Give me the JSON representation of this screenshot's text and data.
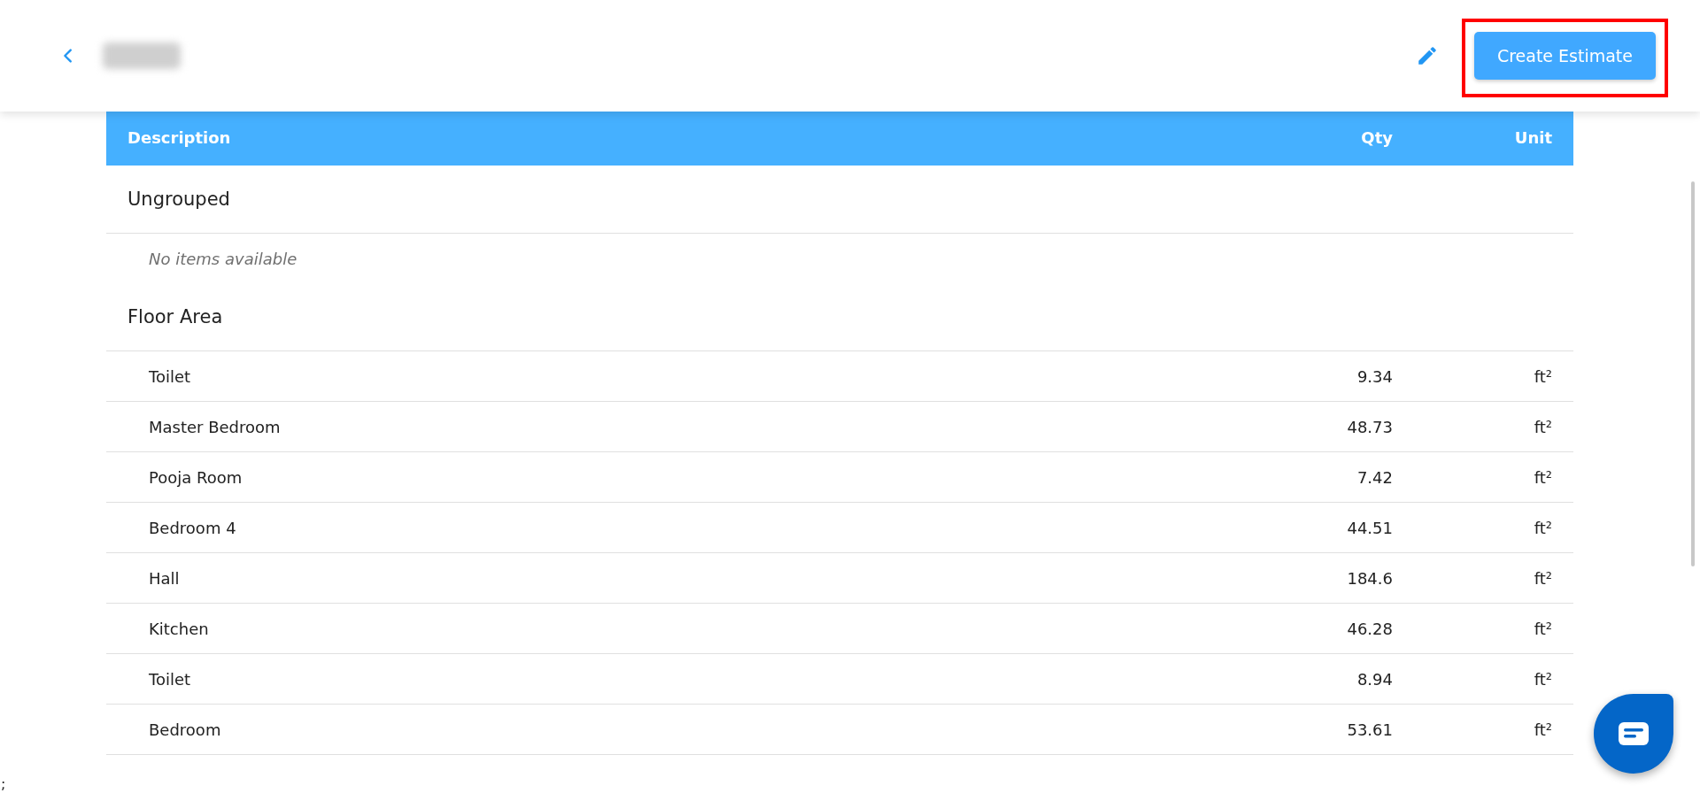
{
  "header": {
    "button": "Create Estimate",
    "highlighted": true
  },
  "table": {
    "columns": [
      "Description",
      "Qty",
      "Unit"
    ],
    "groups": [
      {
        "name": "Ungrouped",
        "empty_text": "No items available"
      },
      {
        "name": "Floor Area",
        "rows": [
          {
            "description": "Toilet",
            "qty": "9.34",
            "unit": "ft²"
          },
          {
            "description": "Master Bedroom",
            "qty": "48.73",
            "unit": "ft²"
          },
          {
            "description": "Pooja Room",
            "qty": "7.42",
            "unit": "ft²"
          },
          {
            "description": "Bedroom 4",
            "qty": "44.51",
            "unit": "ft²"
          },
          {
            "description": "Hall",
            "qty": "184.6",
            "unit": "ft²"
          },
          {
            "description": "Kitchen",
            "qty": "46.28",
            "unit": "ft²"
          },
          {
            "description": "Toilet",
            "qty": "8.94",
            "unit": "ft²"
          },
          {
            "description": "Bedroom",
            "qty": "53.61",
            "unit": "ft²"
          }
        ]
      }
    ]
  },
  "stray_text": ";"
}
